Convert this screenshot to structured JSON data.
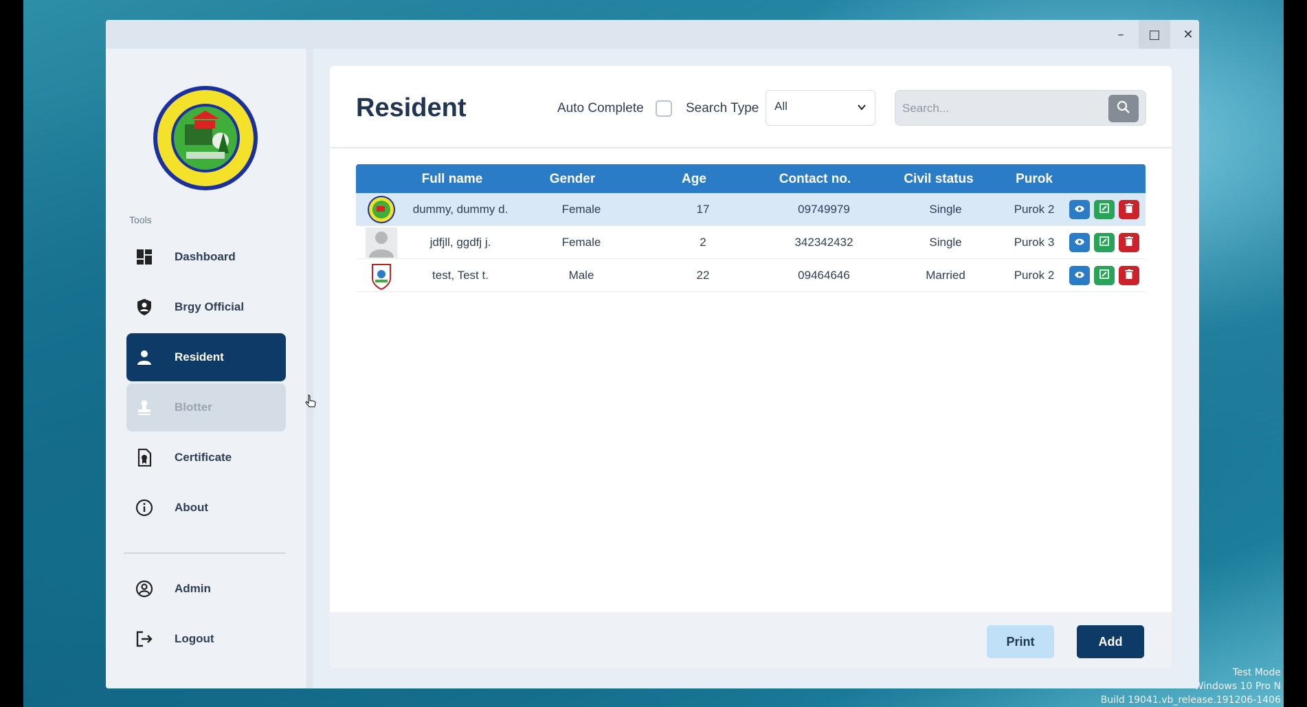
{
  "window": {
    "controls": {
      "minimize": "–",
      "maximize": "□",
      "close": "✕"
    }
  },
  "sidebar": {
    "logo_icon": "barangay-seal-logo",
    "logo_text": "BARANGAY NEW VISAYAS · PANABO CITY · FOUNDED 1949 · REPUBLIC ACT 3780",
    "tools_label": "Tools",
    "items": [
      {
        "label": "Dashboard",
        "icon": "dashboard-icon"
      },
      {
        "label": "Brgy Official",
        "icon": "shield-user-icon"
      },
      {
        "label": "Resident",
        "icon": "person-icon",
        "active": true
      },
      {
        "label": "Blotter",
        "icon": "stamp-icon",
        "hovered": true
      },
      {
        "label": "Certificate",
        "icon": "certificate-file-icon"
      },
      {
        "label": "About",
        "icon": "info-icon"
      }
    ],
    "bottom_items": [
      {
        "label": "Admin",
        "icon": "user-circle-icon"
      },
      {
        "label": "Logout",
        "icon": "logout-icon"
      }
    ]
  },
  "header": {
    "title": "Resident",
    "auto_complete_label": "Auto Complete",
    "auto_complete_checked": false,
    "search_type_label": "Search Type",
    "search_type_value": "All",
    "search_placeholder": "Search...",
    "search_value": ""
  },
  "table": {
    "columns": [
      "Full name",
      "Gender",
      "Age",
      "Contact no.",
      "Civil status",
      "Purok"
    ],
    "rows": [
      {
        "avatar": "barangay-seal-avatar",
        "full_name": "dummy, dummy d.",
        "gender": "Female",
        "age": "17",
        "contact": "09749979",
        "civil_status": "Single",
        "purok": "Purok 2",
        "selected": true
      },
      {
        "avatar": "default-person-avatar",
        "full_name": "jdfjll, ggdfj j.",
        "gender": "Female",
        "age": "2",
        "contact": "342342432",
        "civil_status": "Single",
        "purok": "Purok 3",
        "selected": false
      },
      {
        "avatar": "city-seal-avatar",
        "full_name": "test, Test t.",
        "gender": "Male",
        "age": "22",
        "contact": "09464646",
        "civil_status": "Married",
        "purok": "Purok 2",
        "selected": false
      }
    ],
    "row_actions": [
      "view-icon",
      "edit-icon",
      "delete-icon"
    ]
  },
  "footer": {
    "print_label": "Print",
    "add_label": "Add"
  },
  "os_watermark": {
    "line1": "Test Mode",
    "line2": "Windows 10 Pro N",
    "line3": "Build 19041.vb_release.191206-1406"
  },
  "colors": {
    "primary_dark": "#0d3a66",
    "table_header": "#2a7cc7",
    "view_btn": "#2a7cc7",
    "edit_btn": "#2aa35a",
    "delete_btn": "#cc2229",
    "print_btn": "#bfe0f7"
  }
}
